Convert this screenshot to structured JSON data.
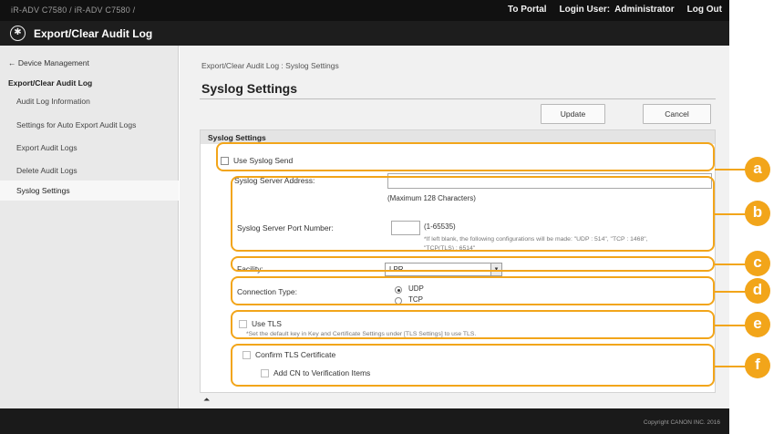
{
  "header": {
    "device_name": "iR-ADV C7580 / iR-ADV C7580 /",
    "to_portal": "To Portal",
    "login_user_label": "Login User:",
    "login_user_value": "Administrator",
    "logout": "Log Out"
  },
  "titlebar": {
    "title": "Export/Clear Audit Log",
    "icon": "gear-star-icon"
  },
  "sidebar": {
    "back_link": "← Device Management",
    "section": "Export/Clear Audit Log",
    "items": [
      {
        "label": "Audit Log Information"
      },
      {
        "label": "Settings for Auto Export Audit Logs"
      },
      {
        "label": "Export Audit Logs"
      },
      {
        "label": "Delete Audit Logs"
      },
      {
        "label": "Syslog Settings",
        "active": true
      }
    ]
  },
  "main": {
    "breadcrumb": "Export/Clear Audit Log : Syslog Settings",
    "title": "Syslog Settings",
    "update_button": "Update",
    "cancel_button": "Cancel",
    "panel_header": "Syslog Settings",
    "use_syslog_send": "Use Syslog Send",
    "server_address_label": "Syslog Server Address:",
    "server_address_value": "",
    "server_address_hint": "(Maximum 128 Characters)",
    "port_label": "Syslog Server Port Number:",
    "port_value": "",
    "port_range": "(1-65535)",
    "port_note_line1": "*If left blank, the following configurations will be made: \"UDP : 514\", \"TCP : 1468\",",
    "port_note_line2": "\"TCP(TLS) : 6514\"",
    "facility_label": "Facility:",
    "facility_value": "LPR",
    "connection_type_label": "Connection Type:",
    "connection_options": [
      {
        "label": "UDP",
        "selected": true
      },
      {
        "label": "TCP",
        "selected": false
      }
    ],
    "use_tls": "Use TLS",
    "tls_note": "*Set the default key in Key and Certificate Settings under [TLS Settings] to use TLS.",
    "confirm_tls_certificate": "Confirm TLS Certificate",
    "add_cn": "Add CN to Verification Items"
  },
  "callouts": [
    "a",
    "b",
    "c",
    "d",
    "e",
    "f"
  ],
  "footer": {
    "copyright": "Copyright CANON INC. 2016"
  },
  "colors": {
    "callout": "#f2a51a",
    "topbar": "#111111",
    "sidebar": "#e9e9e9"
  }
}
